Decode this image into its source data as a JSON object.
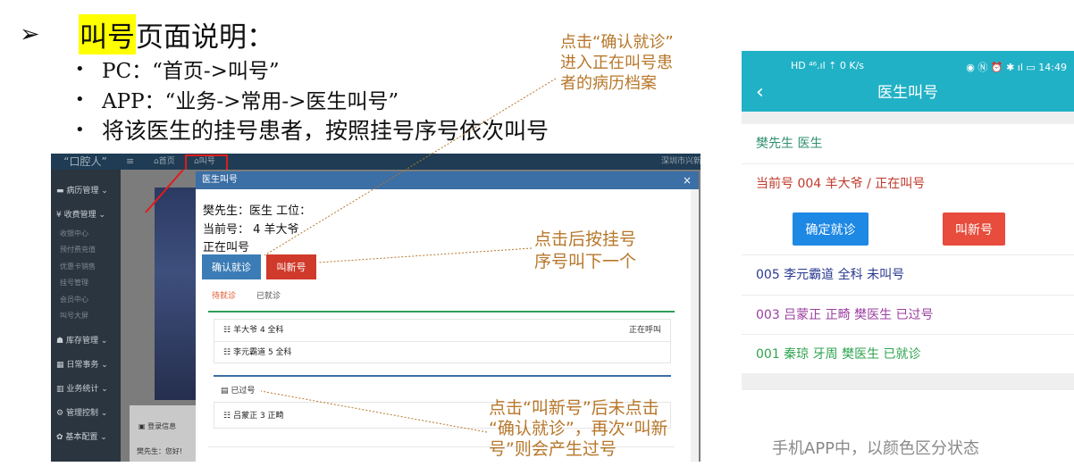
{
  "slide": {
    "arrow": "➢",
    "title_highlight": "叫号",
    "title_rest": "页面说明：",
    "bullets": [
      "PC：“首页->叫号”",
      "APP：“业务->常用->医生叫号”",
      "将该医生的挂号患者，按照挂号序号依次叫号"
    ],
    "notes": {
      "confirm_note": [
        "点击“确认就诊”",
        "进入正在叫号患",
        "者的病历档案"
      ],
      "new_note": [
        "点击后按挂号",
        "序号叫下一个"
      ],
      "passed_note": [
        "点击“叫新号”后未点击",
        "“确认就诊”，再次“叫新",
        "号”则会产生过号"
      ]
    },
    "caption": "手机APP中，以颜色区分状态"
  },
  "pc": {
    "logo": "“口腔人”",
    "menu_icon": "≡",
    "nav_home": "⌂首页",
    "nav_call": "⌂叫号",
    "nav_right": "深圳市兴新",
    "sidebar": {
      "items": [
        "病历管理",
        "收费管理",
        "库存管理",
        "日常事务",
        "业务统计",
        "管理控制",
        "基本配置"
      ],
      "sub_items": [
        "收银中心",
        "预付费充值",
        "优惠卡销售",
        "挂号管理",
        "会员中心",
        "叫号大屏"
      ]
    },
    "login_box": {
      "title": "登录信息",
      "text": "樊先生：您好!"
    },
    "modal": {
      "title": "医生叫号",
      "close": "×",
      "doctor_line": "樊先生：医生 工位：",
      "current_line": "当前号： 4 羊大爷",
      "status_line": "正在叫号",
      "confirm_button": "确认就诊",
      "new_button": "叫新号",
      "tabs": [
        "待就诊",
        "已就诊"
      ],
      "waiting": [
        {
          "text": "羊大爷 4 全科",
          "status": "正在呼叫"
        },
        {
          "text": "李元霸道 5 全科",
          "status": ""
        }
      ],
      "passed_title": "已过号",
      "passed": [
        {
          "text": "吕蒙正 3 正畸"
        }
      ],
      "list_icon": "☷"
    }
  },
  "phone": {
    "status_left": "HD ⁴⁶.ıl ⇡ 0 K/s",
    "status_right": "◉ Ⓝ ⏰ ✱ ıl ▭ 14:49",
    "back": "‹",
    "title": "医生叫号",
    "doctor": "樊先生 医生",
    "current": "当前号 004 羊大爷 / 正在叫号",
    "confirm_button": "确定就诊",
    "new_button": "叫新号",
    "queue": [
      "005 李元霸道 全科 未叫号",
      "003 吕蒙正 正畸 樊医生 已过号",
      "001 秦琼 牙周 樊医生 已就诊"
    ]
  },
  "colors": {
    "highlight": "#ffff00",
    "note": "#b7772a",
    "teal": "#21b1c6",
    "confirm_blue": "#1e88e5",
    "new_red": "#e74c3c",
    "queue_waiting": "#2a3a8f",
    "queue_passed": "#9b3fa0",
    "queue_done": "#2fa34f"
  }
}
